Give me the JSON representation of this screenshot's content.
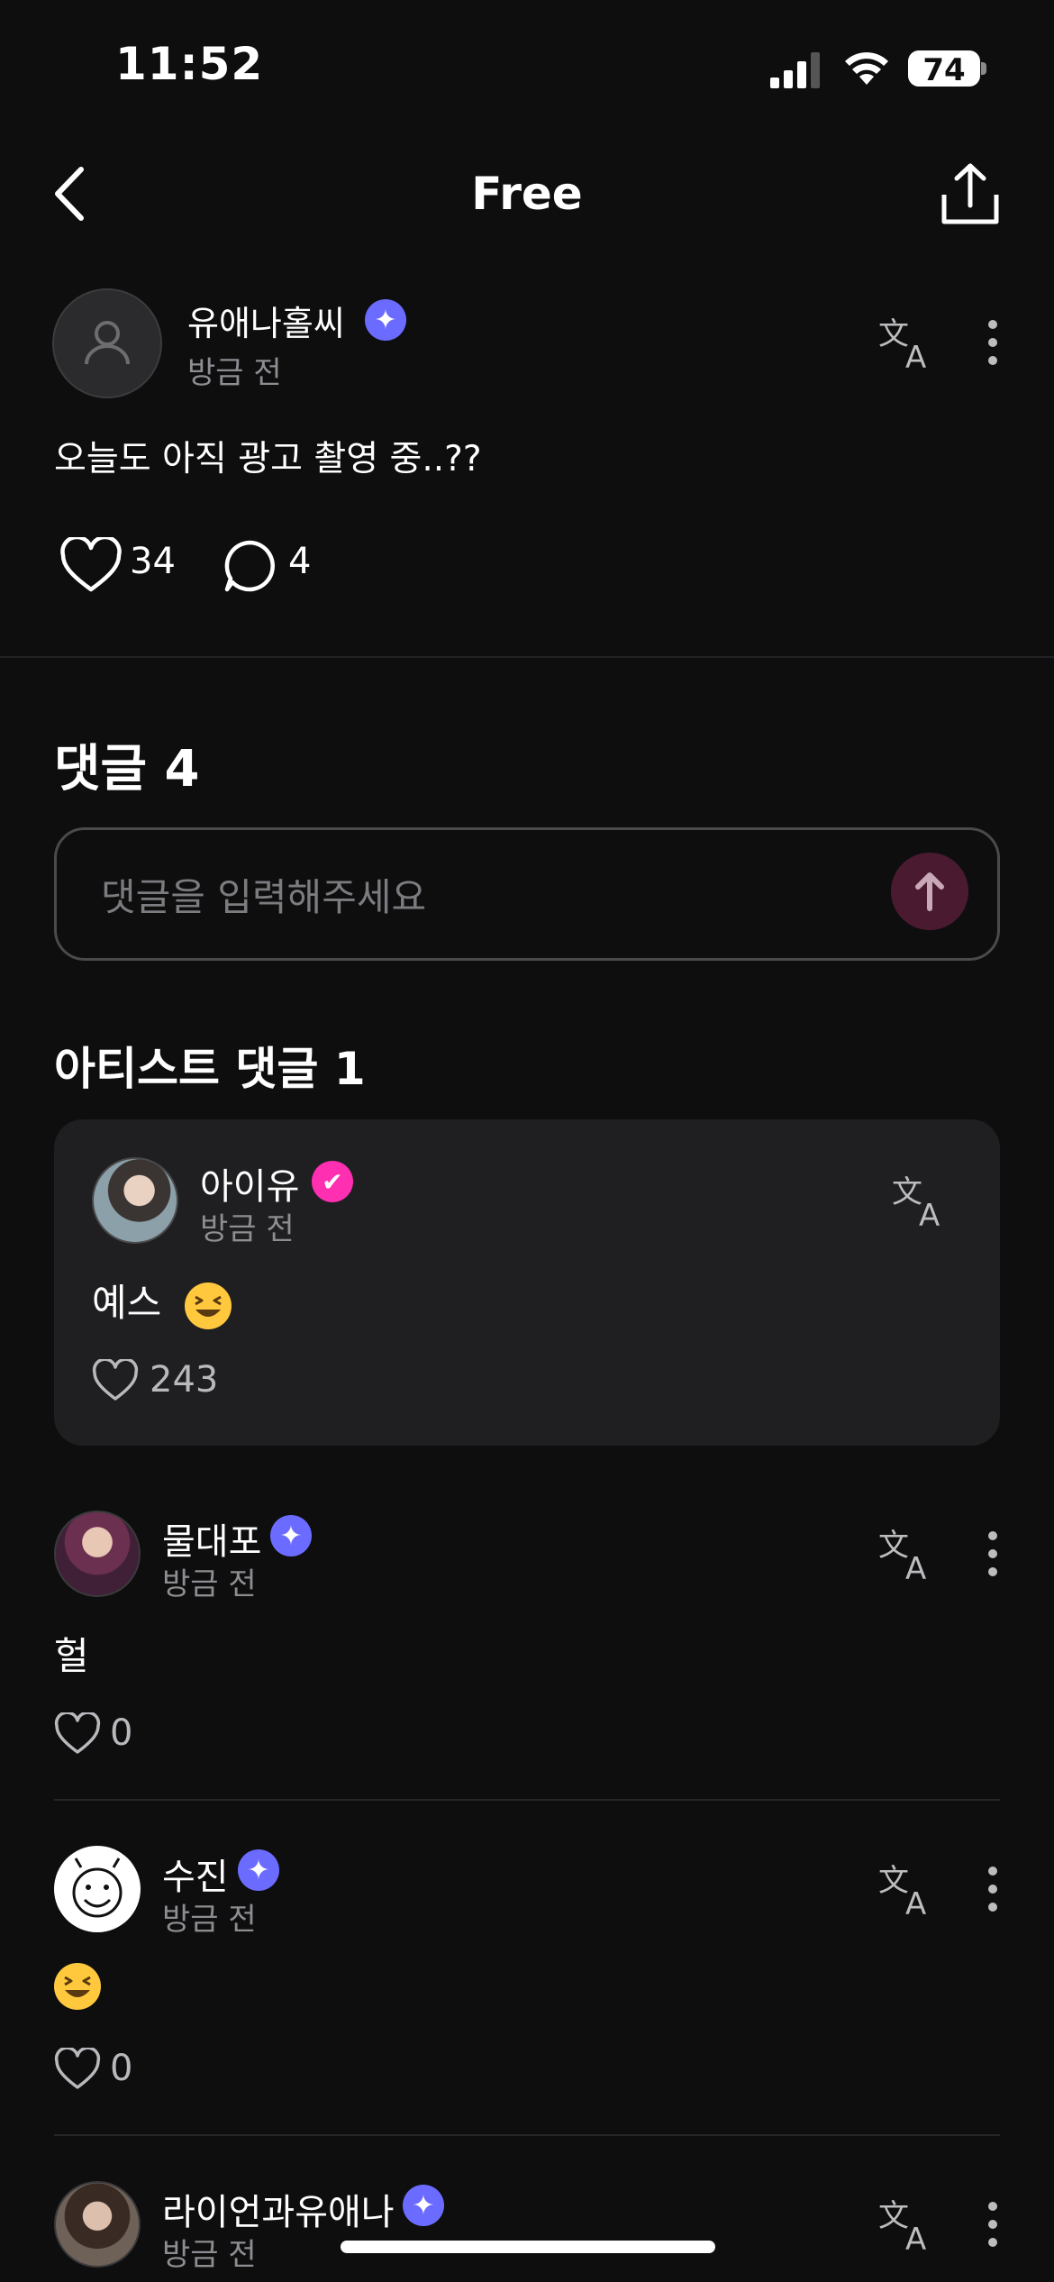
{
  "status_bar": {
    "time": "11:52",
    "battery": "74"
  },
  "header": {
    "title": "Free"
  },
  "post": {
    "author": "유애나홀씨",
    "time": "방금 전",
    "body": "오늘도 아직 광고 촬영 중..??",
    "likes": "34",
    "comments": "4"
  },
  "comments_section": {
    "heading": "댓글 4",
    "input_placeholder": "댓글을 입력해주세요"
  },
  "artist_comments": {
    "heading": "아티스트 댓글 1",
    "items": [
      {
        "name": "아이유",
        "time": "방금 전",
        "body": "예스",
        "likes": "243"
      }
    ]
  },
  "comments": [
    {
      "name": "물대포",
      "time": "방금 전",
      "body": "헐",
      "likes": "0"
    },
    {
      "name": "수진",
      "time": "방금 전",
      "body": "",
      "likes": "0"
    },
    {
      "name": "라이언과유애나",
      "time": "방금 전"
    }
  ],
  "colors": {
    "background": "#0e0e0f",
    "fan_badge": "#6b6cff",
    "artist_badge": "#ff2fb1",
    "send_button": "#4a1b30"
  }
}
